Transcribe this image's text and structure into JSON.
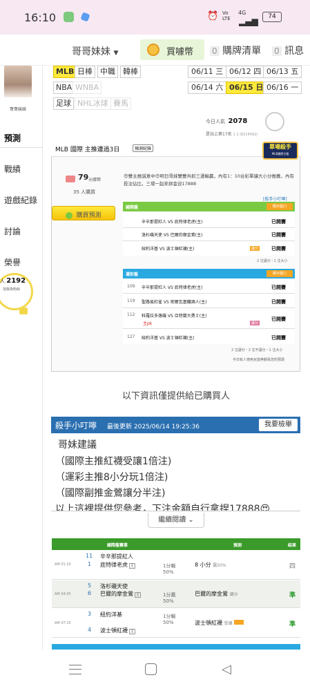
{
  "status": {
    "time": "16:10",
    "battery": "74",
    "volte": "Vo LTE",
    "net": "4G"
  },
  "nav": {
    "tab1": "哥哥妹妹",
    "tab2": "買噱幣",
    "tab3_count": "0",
    "tab3": "購牌清單",
    "tab4_count": "0",
    "tab4": "訊息"
  },
  "profile": {
    "name": "哥哥妹妹"
  },
  "sidebar": {
    "items": [
      "預測",
      "戰績",
      "遊戲紀錄",
      "討論",
      "榮譽"
    ],
    "popularity_prefix": "人",
    "popularity_value": "2192",
    "popularity_sub": "加我為粉絲"
  },
  "leagues": {
    "row1": [
      "MLB",
      "日棒",
      "中職",
      "韓棒"
    ],
    "row2": [
      "NBA",
      "WNBA"
    ],
    "row3": [
      "足球",
      "NHL冰球",
      "賽馬"
    ]
  },
  "dates": {
    "row1": [
      "06/11 三",
      "06/12 四",
      "06/13 五"
    ],
    "row2": [
      "06/14 六",
      "06/15 日",
      "06/16 一"
    ]
  },
  "stats": {
    "today_label": "今日人氣",
    "today_value": "2078",
    "rank": "是站上第17名",
    "rank_suffix": "1 1 (8214562)"
  },
  "card": {
    "title": "MLB 國際 主推連過3日",
    "record_btn": "預測紀錄",
    "sticker_main": "單場殺手",
    "sticker_sub": "MLB國際主推",
    "price_value": "79",
    "price_unit": "元噱幣",
    "buyers": "35 人購買",
    "buy_label": "購買預測",
    "notice": "😍雙主推誠意中😍明日哥妹雙雙共抓三運輸贏，內有1：10台彩單讓大小分推薦，內有投注佔比，三場一起來拼金迎17888",
    "tip_link": "[殺手小叮嚀]",
    "intl": {
      "header": "國際盤",
      "btn": "顯示盤口",
      "rows": [
        {
          "match": "辛辛那提紅人 VS 底特律老虎(主)",
          "status": "已開賽"
        },
        {
          "match": "洛杉磯天使 VS 巴爾的摩金鶯(主)",
          "status": "已開賽"
        },
        {
          "match": "紐約洋基 VS 波士頓紅襪(主)",
          "status": "已開賽",
          "tag": "讓分"
        }
      ],
      "footer": "2 注讓分・1 注大小"
    },
    "lottery": {
      "header": "運彩盤",
      "btn": "顯示盤口",
      "rows": [
        {
          "num": "109",
          "match": "辛辛那提紅人 VS 底特律老虎(主)",
          "status": "已開賽"
        },
        {
          "num": "119",
          "match": "聖路易紅雀 VS 密爾瓦基釀酒人(主)",
          "status": "已開賽"
        },
        {
          "num": "112",
          "match": "科羅拉多落磯 VS 亞特蘭大勇士(主)",
          "status": "已開賽",
          "sub": "主pk",
          "tag": "讓分"
        },
        {
          "num": "127",
          "match": "紐約洋基 VS 波士頓紅襪(主)",
          "status": "已開賽"
        }
      ],
      "footer": "2 注讓分・2 注不讓分・1 注大小",
      "footer2": "今日有人使用兌換券觀看您的預測"
    }
  },
  "purchase_note": "以下資訊僅提供給已購買人",
  "tips": {
    "title": "殺手小叮嚀",
    "updated": "最後更新 2025/06/14 19:25:36",
    "report_btn": "我要檢舉",
    "lines": [
      "哥妹建議",
      "（國際主推紅襪受讓1倍注)",
      "（運彩主推8小分玩1倍注)",
      "（國際副推金鶯讓分半注)",
      "以上這裡提供您參考，下注金額自行拿捏17888😍"
    ],
    "continue": "繼續閱讀"
  },
  "results": {
    "headers": [
      "國際盤賽事",
      "預測",
      "結果"
    ],
    "rows": [
      {
        "time": "AM 01:10",
        "num_top": "11",
        "num_bottom": "1",
        "team_top": "辛辛那提紅人",
        "team_bottom": "底特律老虎",
        "line_top": "1分輸",
        "line_bottom": "50%",
        "pick": "8 小分",
        "pick_sub": "贏50%",
        "result": "四"
      },
      {
        "time": "AM 04:05",
        "num_top": "5",
        "num_bottom": "6",
        "team_top": "洛杉磯天使",
        "team_bottom": "巴爾的摩金鶯",
        "line_top": "1分贏",
        "line_bottom": "50%",
        "pick": "巴爾的摩金鶯",
        "pick_sub": "讓分",
        "result": "準"
      },
      {
        "time": "AM 07:15",
        "num_top": "3",
        "num_bottom": "4",
        "team_top": "紐約洋基",
        "team_bottom": "波士頓紅襪",
        "line_top": "1分輸",
        "line_bottom": "50%",
        "pick": "波士頓紅襪",
        "pick_sub": "受讓",
        "result": "準"
      }
    ]
  }
}
